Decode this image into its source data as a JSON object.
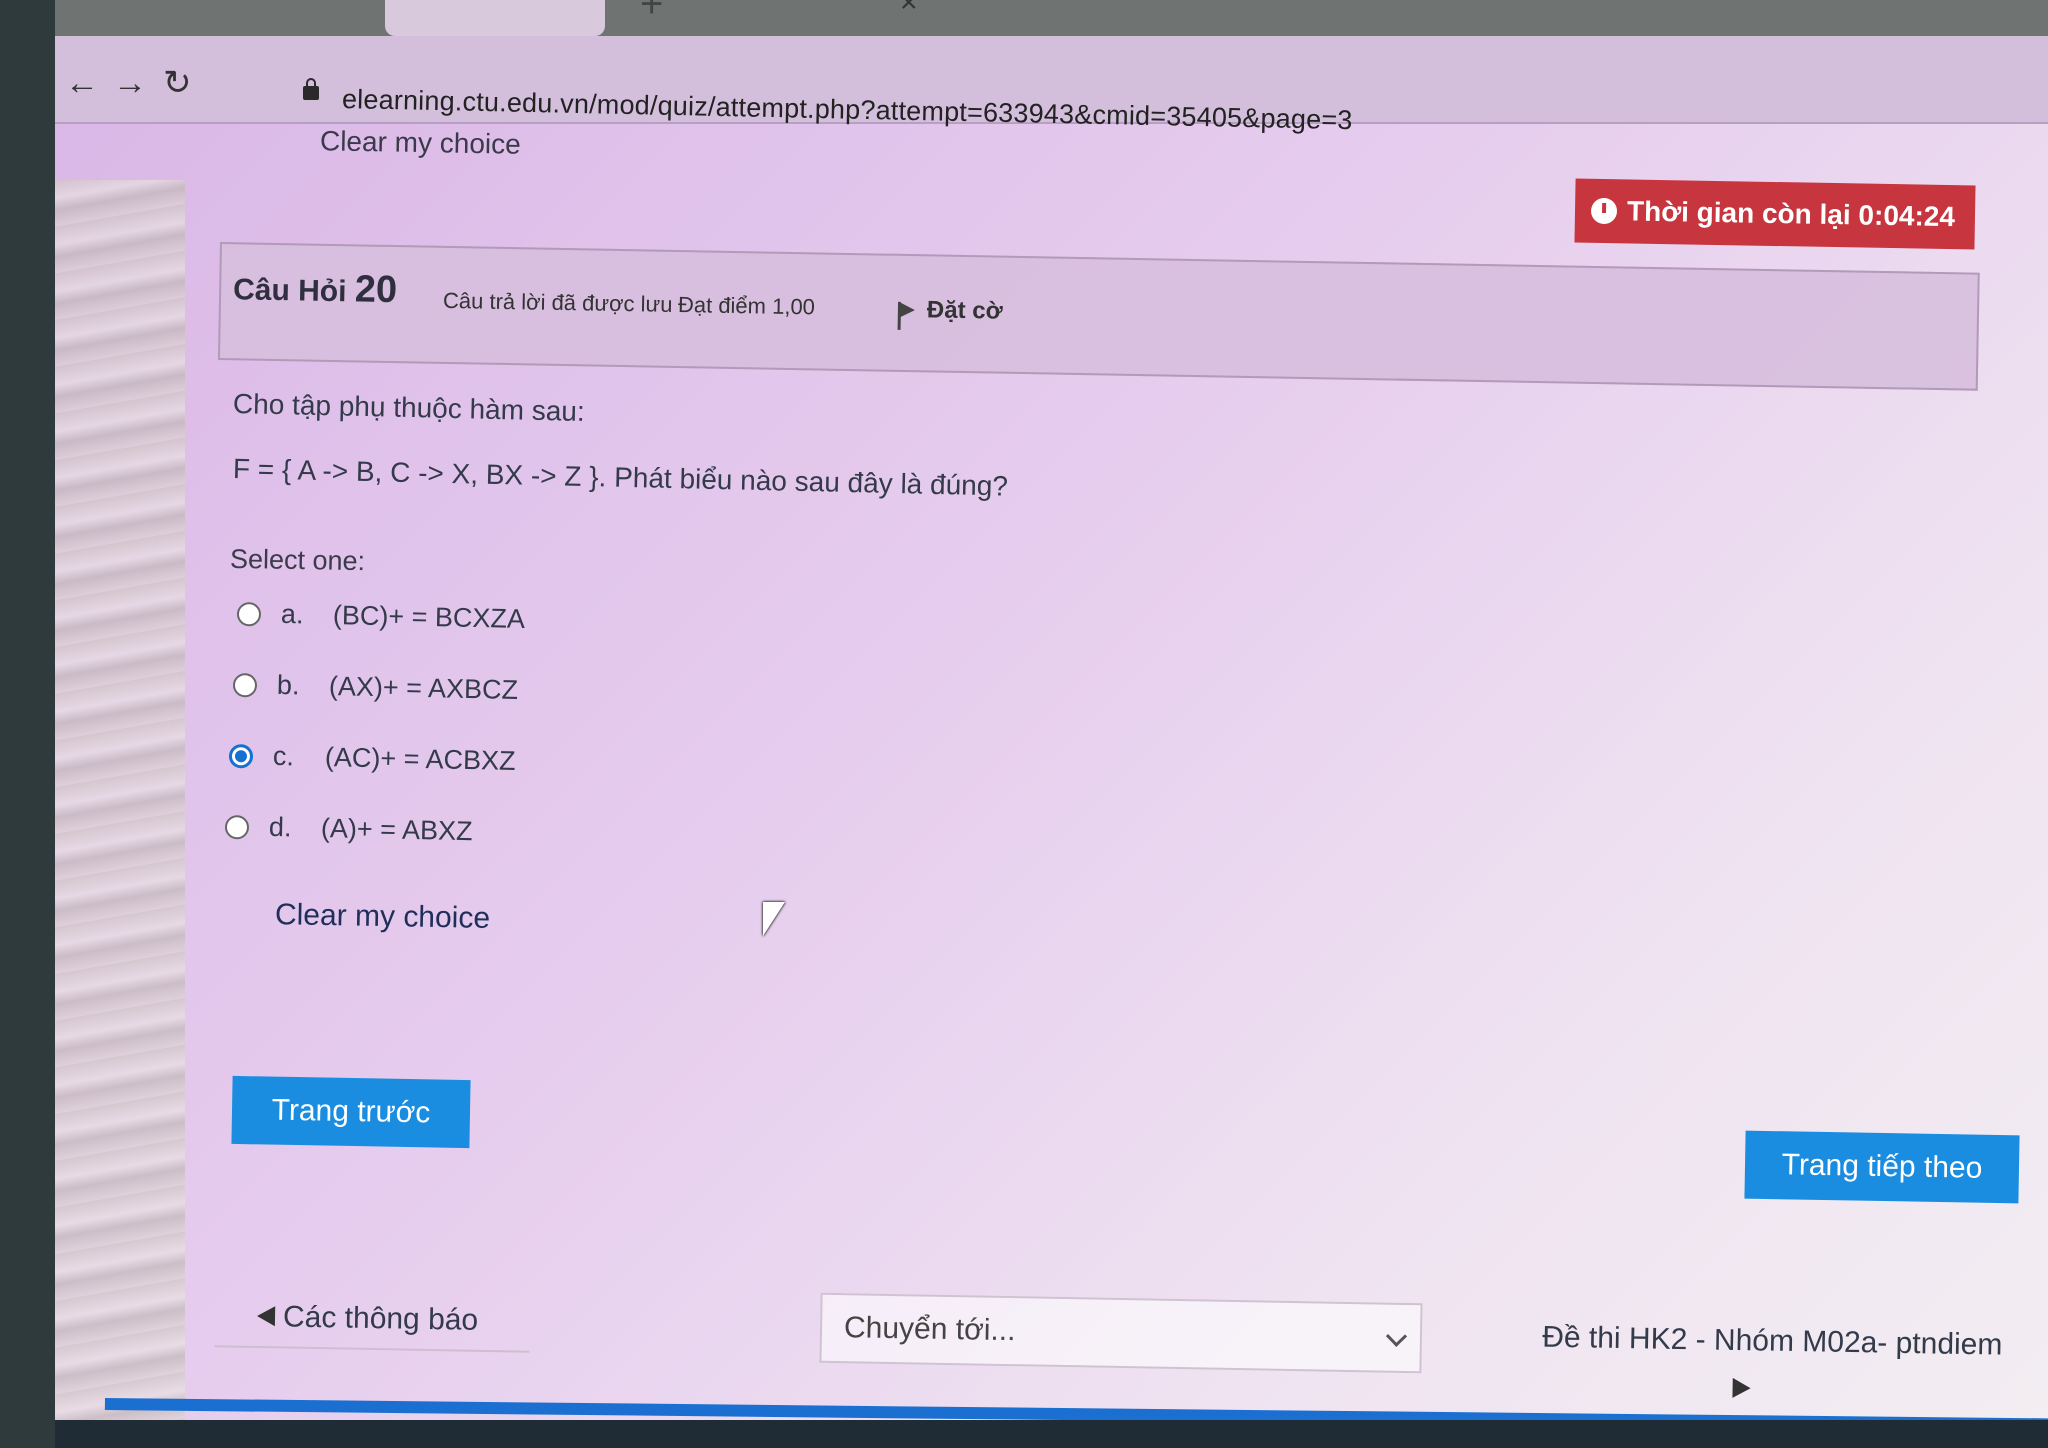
{
  "browser": {
    "url": "elearning.ctu.edu.vn/mod/quiz/attempt.php?attempt=633943&cmid=35405&page=3",
    "nav_icons": [
      "back-arrow-icon",
      "forward-arrow-icon",
      "reload-icon",
      "lock-icon"
    ],
    "tab_close_glyph": "×",
    "new_tab_glyph": "+"
  },
  "clear_top_label": "Clear my choice",
  "timer": {
    "label": "Thời gian còn lại 0:04:24",
    "color": "#c7353f"
  },
  "question": {
    "title_prefix": "Câu Hỏi",
    "number": "20",
    "status": "Câu trả lời đã được lưu",
    "mark": "Đạt điểm 1,00",
    "flag_label": "Đặt cờ",
    "text_line1": "Cho tập phụ thuộc hàm sau:",
    "text_line2": "F = { A -> B, C -> X, BX -> Z }. Phát biểu nào sau đây là đúng?",
    "select_one": "Select one:",
    "options": [
      {
        "letter": "a.",
        "text": "(BC)+ = BCXZA",
        "checked": false
      },
      {
        "letter": "b.",
        "text": "(AX)+ = AXBCZ",
        "checked": false
      },
      {
        "letter": "c.",
        "text": "(AC)+ = ACBXZ",
        "checked": true
      },
      {
        "letter": "d.",
        "text": "(A)+ = ABXZ",
        "checked": false
      }
    ],
    "clear_label": "Clear my choice"
  },
  "navigation": {
    "prev_button": "Trang trước",
    "next_button": "Trang tiếp theo",
    "button_color": "#1a8de0"
  },
  "footer": {
    "prev_activity": "Các thông báo",
    "jump_placeholder": "Chuyển tới...",
    "next_activity": "Đề thi HK2 - Nhóm M02a- ptndiem"
  }
}
